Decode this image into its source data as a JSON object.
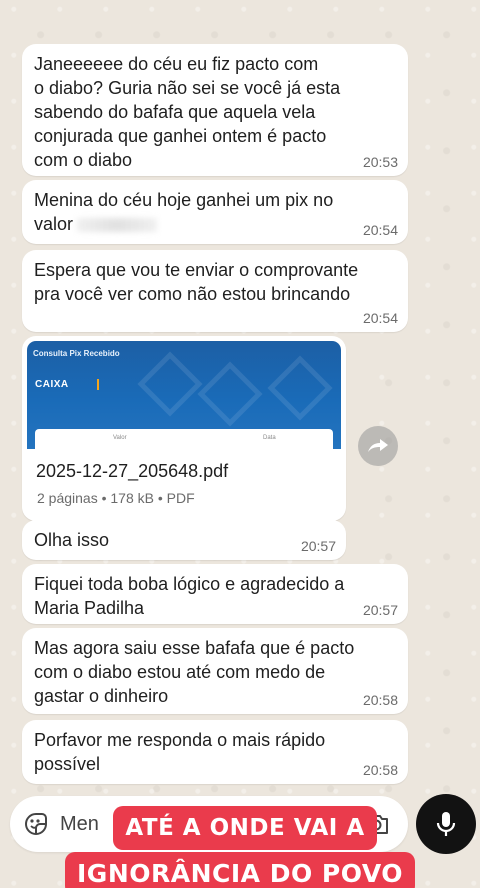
{
  "messages": [
    {
      "text": "Janeeeeee do céu eu fiz pacto com\no diabo? Guria não sei se você já esta\nsabendo do bafafa que aquela vela\nconjurada que ganhei ontem é pacto\ncom o diabo",
      "time": "20:53"
    },
    {
      "text": "Menina do céu hoje ganhei um pix no\nvalor",
      "time": "20:54"
    },
    {
      "text": "Espera que vou te enviar o comprovante\npra você ver como não estou brincando",
      "time": "20:54"
    },
    {
      "text": "Olha isso",
      "time": "20:57"
    },
    {
      "text": "Fiquei toda boba lógico e agradecido a\nMaria Padilha",
      "time": "20:57"
    },
    {
      "text": "Mas agora saiu esse bafafa que é pacto\ncom o diabo estou até com medo de\ngastar o dinheiro",
      "time": "20:58"
    },
    {
      "text": "Porfavor me responda o mais rápido\npossível",
      "time": "20:58"
    }
  ],
  "attachment": {
    "preview_header": "Consulta Pix Recebido",
    "preview_brand": "CAIXA",
    "preview_col1": "Valor",
    "preview_col2": "Data",
    "filename": "2025-12-27_205648.pdf",
    "meta": "2 páginas • 178 kB • PDF"
  },
  "composer": {
    "value": "Men"
  },
  "caption": {
    "line1": "ATÉ A ONDE VAI A",
    "line2": "IGNORÂNCIA DO POVO"
  },
  "icons": {
    "sticker": "sticker-icon",
    "camera": "camera-icon",
    "mic": "mic-icon",
    "forward": "forward-icon"
  },
  "colors": {
    "caption_red": "#ea3b4c",
    "mic_bg": "#121212",
    "bubble": "#ffffff",
    "pdf_blue": "#1c5fa5"
  }
}
